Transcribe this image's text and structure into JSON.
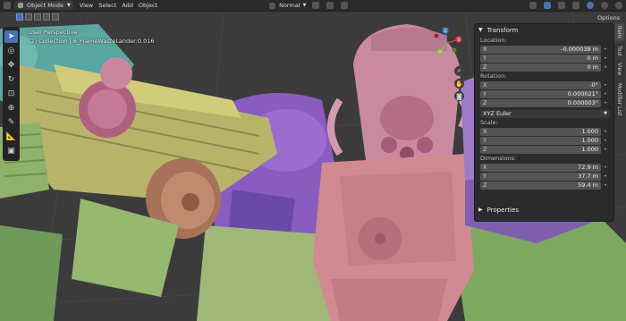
{
  "header": {
    "mode": "Object Mode",
    "menus": [
      "View",
      "Select",
      "Add",
      "Object"
    ],
    "orientation": "Normal",
    "options_label": "Options"
  },
  "viewport": {
    "perspective": "User Perspective",
    "collection": "(2) Collection | 6_FrameWasteLander:0.016"
  },
  "gizmo": {
    "x": "X",
    "y": "Y",
    "z": "Z"
  },
  "npanel": {
    "transform_title": "Transform",
    "location_label": "Location:",
    "location": [
      {
        "axis": "X",
        "value": "-0.000038 m"
      },
      {
        "axis": "Y",
        "value": "0 m"
      },
      {
        "axis": "Z",
        "value": "0 m"
      }
    ],
    "rotation_label": "Rotation:",
    "rotation": [
      {
        "axis": "X",
        "value": "-0°"
      },
      {
        "axis": "Y",
        "value": "0.000021°"
      },
      {
        "axis": "Z",
        "value": "0.000003°"
      }
    ],
    "rotation_mode": "XYZ Euler",
    "scale_label": "Scale:",
    "scale": [
      {
        "axis": "X",
        "value": "1.000"
      },
      {
        "axis": "Y",
        "value": "1.000"
      },
      {
        "axis": "Z",
        "value": "1.000"
      }
    ],
    "dimensions_label": "Dimensions:",
    "dimensions": [
      {
        "axis": "X",
        "value": "72.9 m"
      },
      {
        "axis": "Y",
        "value": "37.7 m"
      },
      {
        "axis": "Z",
        "value": "59.4 m"
      }
    ],
    "properties_title": "Properties"
  },
  "side_tabs": [
    "Item",
    "Tool",
    "View",
    "Modifier List"
  ],
  "colors": {
    "accent": "#4772b3",
    "helmet": "#c98aa0",
    "arm": "#b7b46a",
    "teal": "#5aa6a0",
    "purple": "#8a5cc0"
  }
}
